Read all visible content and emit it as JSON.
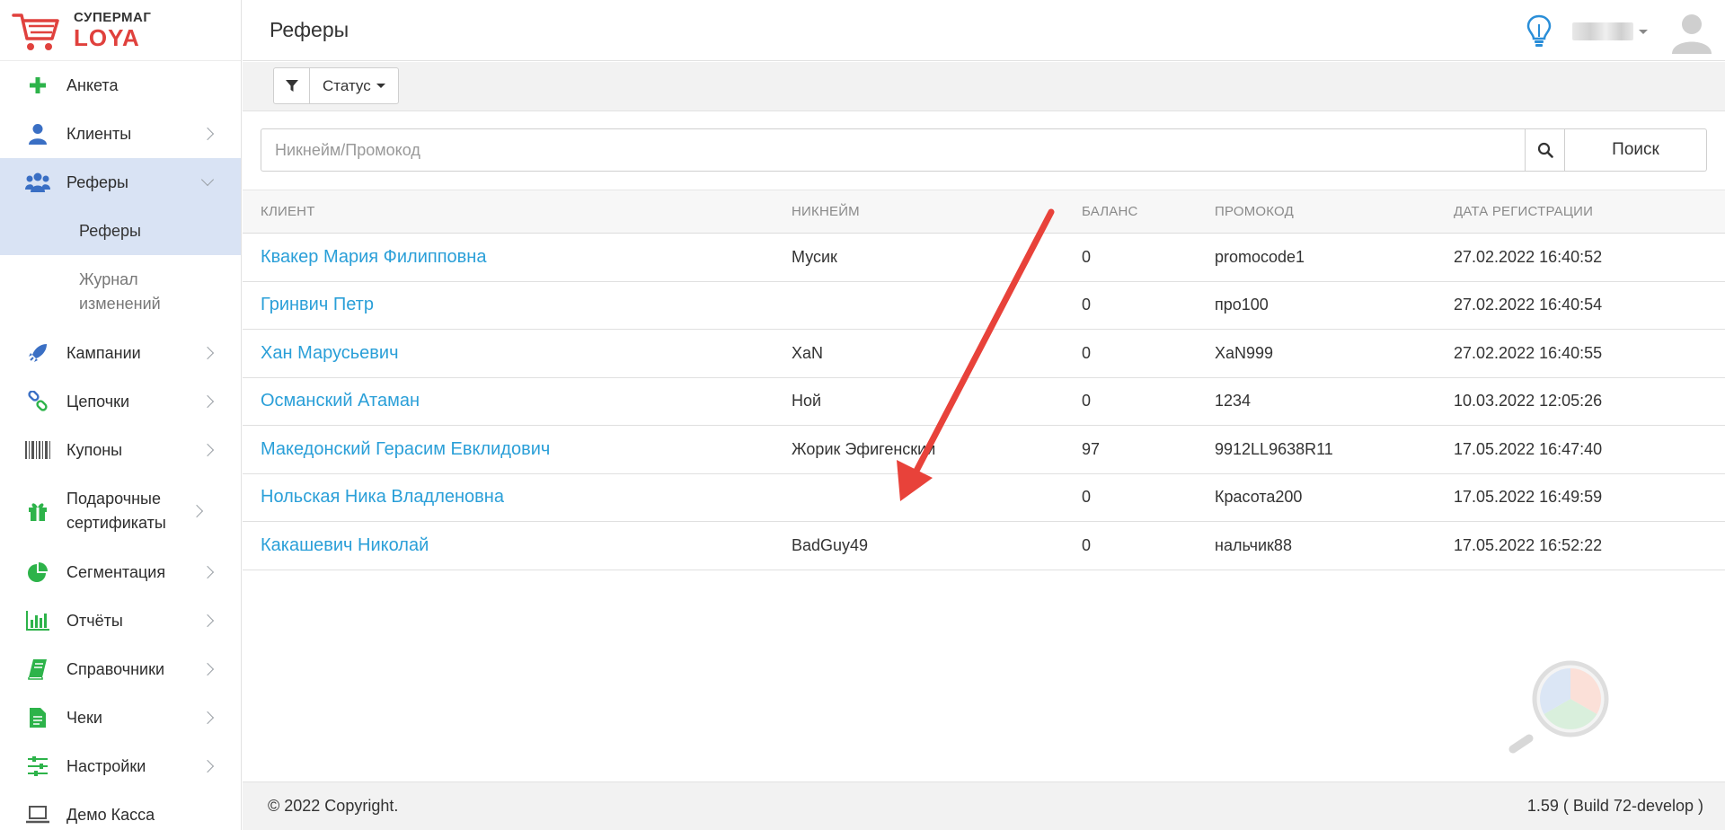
{
  "brand": {
    "top": "СУПЕРМАГ",
    "bottom": "LOYA"
  },
  "header": {
    "title": "Реферы"
  },
  "sidebar": {
    "items": [
      {
        "label": "Анкета"
      },
      {
        "label": "Клиенты"
      },
      {
        "label": "Реферы"
      },
      {
        "label": "Кампании"
      },
      {
        "label": "Цепочки"
      },
      {
        "label": "Купоны"
      },
      {
        "label": "Подарочные сертификаты"
      },
      {
        "label": "Сегментация"
      },
      {
        "label": "Отчёты"
      },
      {
        "label": "Справочники"
      },
      {
        "label": "Чеки"
      },
      {
        "label": "Настройки"
      },
      {
        "label": "Демо Касса"
      }
    ],
    "sub_items": [
      {
        "label": "Реферы"
      },
      {
        "label": "Журнал изменений"
      }
    ]
  },
  "filters": {
    "status_label": "Статус"
  },
  "search": {
    "placeholder": "Никнейм/Промокод",
    "value": "",
    "button_label": "Поиск"
  },
  "table": {
    "columns": [
      "КЛИЕНТ",
      "НИКНЕЙМ",
      "БАЛАНС",
      "ПРОМОКОД",
      "ДАТА РЕГИСТРАЦИИ"
    ],
    "rows": [
      {
        "client": "Квакер Мария Филипповна",
        "nickname": "Мусик",
        "balance": "0",
        "promocode": "promocode1",
        "date": "27.02.2022 16:40:52"
      },
      {
        "client": "Гринвич Петр",
        "nickname": "",
        "balance": "0",
        "promocode": "про100",
        "date": "27.02.2022 16:40:54"
      },
      {
        "client": "Хан Марусьевич",
        "nickname": "XaN",
        "balance": "0",
        "promocode": "XaN999",
        "date": "27.02.2022 16:40:55"
      },
      {
        "client": "Османский Атаман",
        "nickname": "Ной",
        "balance": "0",
        "promocode": "1234",
        "date": "10.03.2022 12:05:26"
      },
      {
        "client": "Македонский Герасим Евклидович",
        "nickname": "Жорик Эфигенский",
        "balance": "97",
        "promocode": "9912LL9638R11",
        "date": "17.05.2022 16:47:40"
      },
      {
        "client": "Нольская Ника Владленовна",
        "nickname": "",
        "balance": "0",
        "promocode": "Красота200",
        "date": "17.05.2022 16:49:59"
      },
      {
        "client": "Какашевич Николай",
        "nickname": "BadGuy49",
        "balance": "0",
        "promocode": "нальчик88",
        "date": "17.05.2022 16:52:22"
      }
    ]
  },
  "footer": {
    "copyright": "© 2022 Copyright.",
    "version": "1.59 ( Build 72-develop )"
  },
  "colors": {
    "accent_link": "#2a9fd8",
    "brand_red": "#e0413d",
    "icon_green": "#2db34a",
    "icon_blue": "#3a6fc4",
    "arrow_red": "#e8423a"
  },
  "icons": [
    "plus-icon",
    "user-icon",
    "users-icon",
    "rocket-icon",
    "chain-icon",
    "barcode-icon",
    "gift-icon",
    "pie-chart-icon",
    "bar-chart-icon",
    "book-icon",
    "document-icon",
    "sliders-icon",
    "laptop-icon",
    "filter-icon",
    "search-icon",
    "lightbulb-icon",
    "avatar-icon"
  ]
}
